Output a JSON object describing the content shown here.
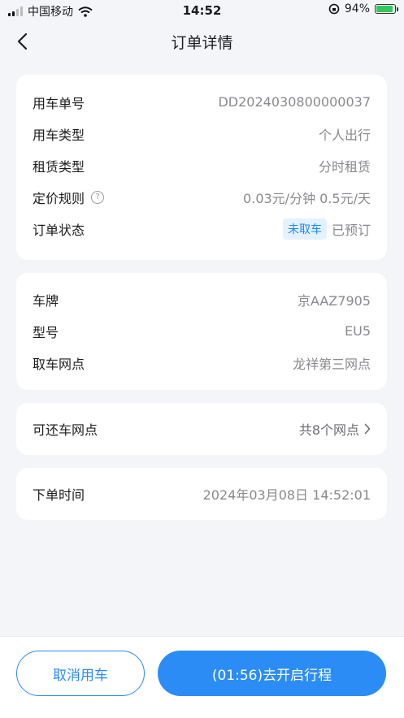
{
  "status_bar": {
    "carrier": "中国移动",
    "time": "14:52",
    "battery": "94%"
  },
  "nav": {
    "title": "订单详情"
  },
  "order_card": {
    "order_no_label": "用车单号",
    "order_no_value": "DD2024030800000037",
    "car_use_type_label": "用车类型",
    "car_use_type_value": "个人出行",
    "lease_type_label": "租赁类型",
    "lease_type_value": "分时租赁",
    "pricing_label": "定价规则",
    "pricing_value": "0.03元/分钟 0.5元/天",
    "status_label": "订单状态",
    "status_badge": "未取车",
    "status_value": "已预订"
  },
  "car_card": {
    "plate_label": "车牌",
    "plate_value": "京AAZ7905",
    "model_label": "型号",
    "model_value": "EU5",
    "pickup_label": "取车网点",
    "pickup_value": "龙祥第三网点"
  },
  "return_card": {
    "label": "可还车网点",
    "value": "共8个网点"
  },
  "time_card": {
    "label": "下单时间",
    "value": "2024年03月08日 14:52:01"
  },
  "footer": {
    "cancel_label": "取消用车",
    "start_label": "(01:56)去开启行程"
  },
  "colors": {
    "accent": "#2b8cf6",
    "badge_bg": "#e4f1ff",
    "background": "#f3f5f9"
  }
}
